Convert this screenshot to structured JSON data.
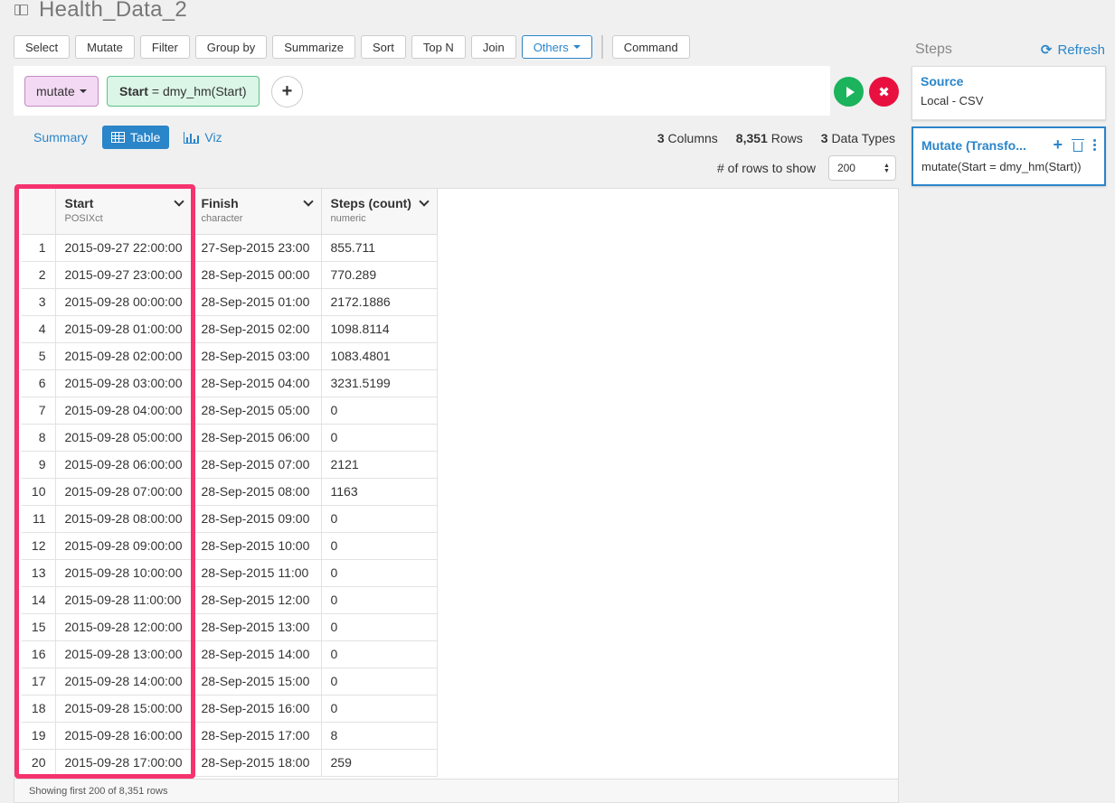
{
  "page": {
    "title": "Health_Data_2"
  },
  "toolbar": {
    "buttons": [
      "Select",
      "Mutate",
      "Filter",
      "Group by",
      "Summarize",
      "Sort",
      "Top N",
      "Join"
    ],
    "others_label": "Others",
    "command_label": "Command"
  },
  "command": {
    "verb_label": "mutate",
    "expr_column": "Start",
    "expr_rest": "= dmy_hm(Start)"
  },
  "views": {
    "summary_label": "Summary",
    "table_label": "Table",
    "viz_label": "Viz",
    "active": "Table"
  },
  "stats": {
    "columns_count": "3",
    "columns_label": "Columns",
    "rows_count": "8,351",
    "rows_label": "Rows",
    "types_count": "3",
    "types_label": "Data Types"
  },
  "rows_to_show": {
    "label": "# of rows to show",
    "value": "200"
  },
  "table": {
    "columns": [
      {
        "name": "Start",
        "type": "POSIXct"
      },
      {
        "name": "Finish",
        "type": "character"
      },
      {
        "name": "Steps (count)",
        "type": "numeric"
      }
    ],
    "rows": [
      [
        "1",
        "2015-09-27 22:00:00",
        "27-Sep-2015 23:00",
        "855.711"
      ],
      [
        "2",
        "2015-09-27 23:00:00",
        "28-Sep-2015 00:00",
        "770.289"
      ],
      [
        "3",
        "2015-09-28 00:00:00",
        "28-Sep-2015 01:00",
        "2172.1886"
      ],
      [
        "4",
        "2015-09-28 01:00:00",
        "28-Sep-2015 02:00",
        "1098.8114"
      ],
      [
        "5",
        "2015-09-28 02:00:00",
        "28-Sep-2015 03:00",
        "1083.4801"
      ],
      [
        "6",
        "2015-09-28 03:00:00",
        "28-Sep-2015 04:00",
        "3231.5199"
      ],
      [
        "7",
        "2015-09-28 04:00:00",
        "28-Sep-2015 05:00",
        "0"
      ],
      [
        "8",
        "2015-09-28 05:00:00",
        "28-Sep-2015 06:00",
        "0"
      ],
      [
        "9",
        "2015-09-28 06:00:00",
        "28-Sep-2015 07:00",
        "2121"
      ],
      [
        "10",
        "2015-09-28 07:00:00",
        "28-Sep-2015 08:00",
        "1163"
      ],
      [
        "11",
        "2015-09-28 08:00:00",
        "28-Sep-2015 09:00",
        "0"
      ],
      [
        "12",
        "2015-09-28 09:00:00",
        "28-Sep-2015 10:00",
        "0"
      ],
      [
        "13",
        "2015-09-28 10:00:00",
        "28-Sep-2015 11:00",
        "0"
      ],
      [
        "14",
        "2015-09-28 11:00:00",
        "28-Sep-2015 12:00",
        "0"
      ],
      [
        "15",
        "2015-09-28 12:00:00",
        "28-Sep-2015 13:00",
        "0"
      ],
      [
        "16",
        "2015-09-28 13:00:00",
        "28-Sep-2015 14:00",
        "0"
      ],
      [
        "17",
        "2015-09-28 14:00:00",
        "28-Sep-2015 15:00",
        "0"
      ],
      [
        "18",
        "2015-09-28 15:00:00",
        "28-Sep-2015 16:00",
        "0"
      ],
      [
        "19",
        "2015-09-28 16:00:00",
        "28-Sep-2015 17:00",
        "8"
      ],
      [
        "20",
        "2015-09-28 17:00:00",
        "28-Sep-2015 18:00",
        "259"
      ]
    ],
    "footer": "Showing first 200 of 8,351 rows"
  },
  "steps": {
    "title": "Steps",
    "refresh_label": "Refresh",
    "items": [
      {
        "name": "Source",
        "desc": "Local - CSV"
      },
      {
        "name": "Mutate (Transfo...",
        "desc": "mutate(Start = dmy_hm(Start))"
      }
    ]
  },
  "colors": {
    "accent": "#2a85c9",
    "highlight": "#f5336e",
    "run": "#1bb35c",
    "cancel": "#e8103e",
    "mutate_pill": "#f3d9f3",
    "expr_pill": "#dbf5e6"
  }
}
